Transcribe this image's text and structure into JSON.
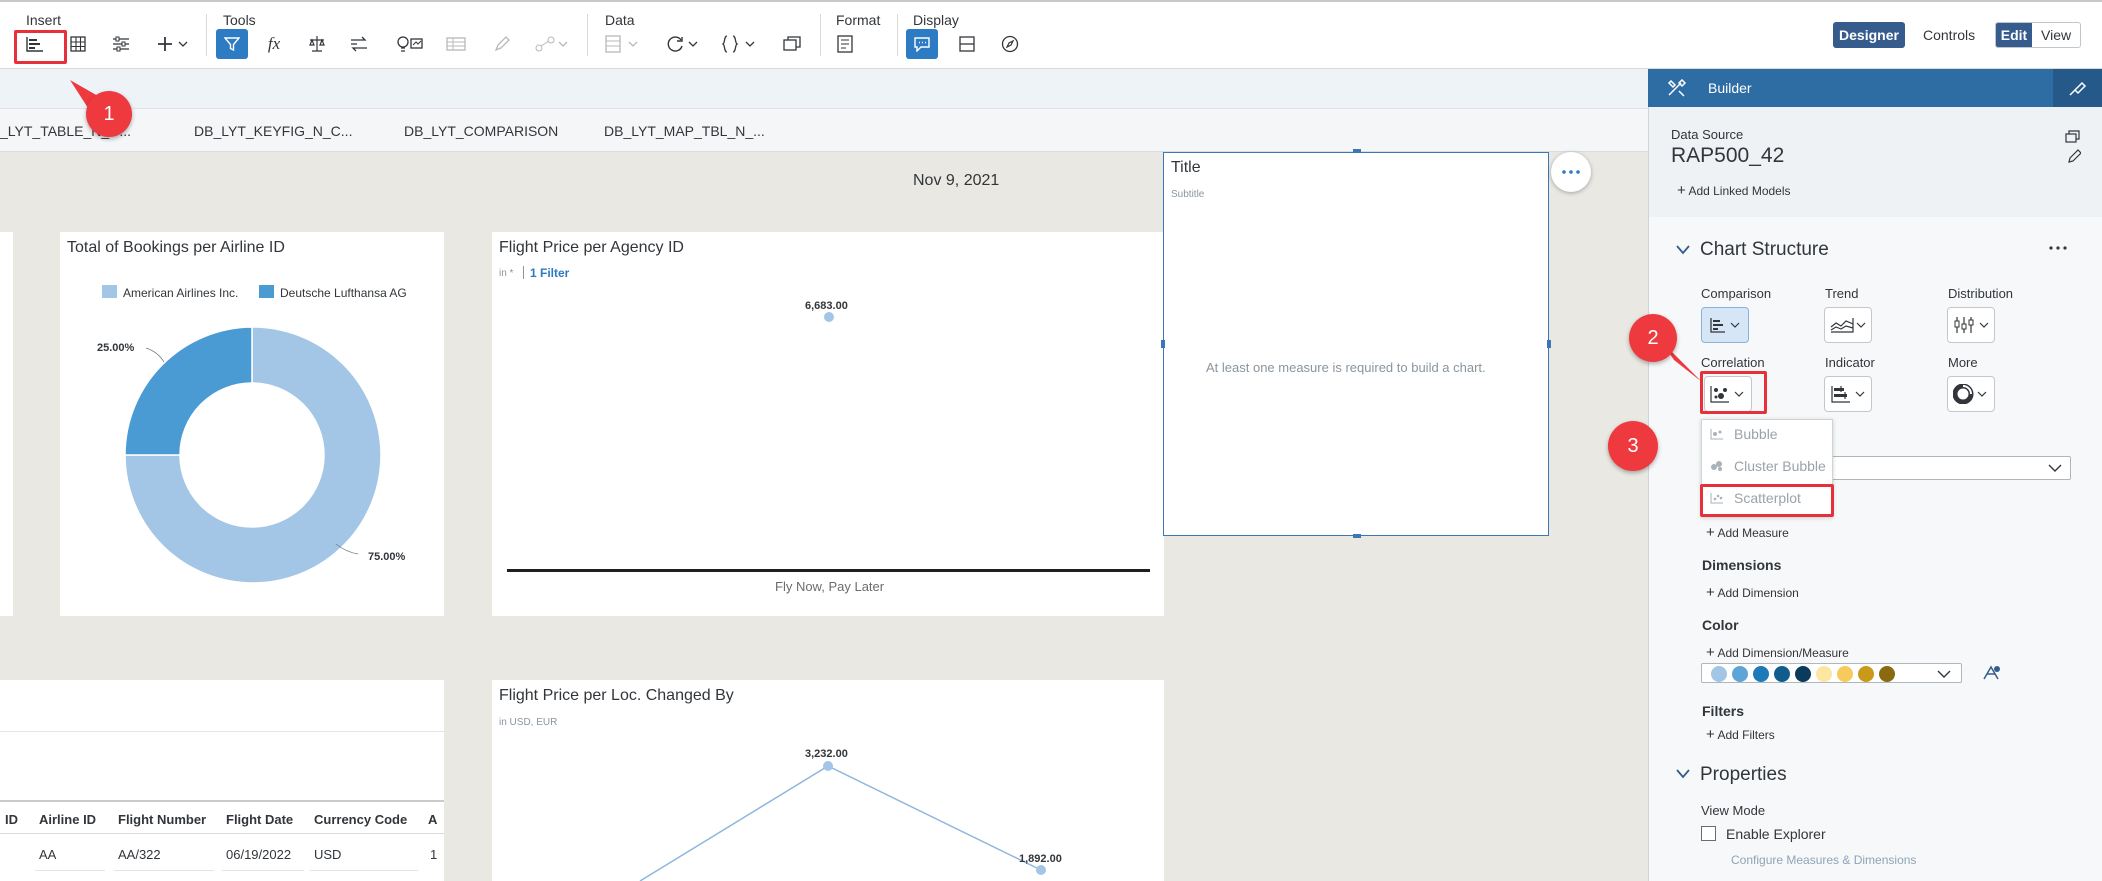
{
  "toolbar": {
    "groups": {
      "insert": "Insert",
      "tools": "Tools",
      "data": "Data",
      "format": "Format",
      "display": "Display"
    },
    "designer": "Designer",
    "controls": "Controls",
    "edit": "Edit",
    "view": "View"
  },
  "tabs": [
    "_LYT_TABLE_N_C...",
    "DB_LYT_KEYFIG_N_C...",
    "DB_LYT_COMPARISON",
    "DB_LYT_MAP_TBL_N_..."
  ],
  "canvas": {
    "date": "Nov 9, 2021"
  },
  "donut_card": {
    "title": "Total of Bookings per Airline ID",
    "legend": [
      "American Airlines Inc.",
      "Deutsche Lufthansa AG"
    ],
    "labels": [
      "25.00%",
      "75.00%"
    ]
  },
  "agency_card": {
    "title": "Flight Price per Agency ID",
    "unit": "in *",
    "filter": "1 Filter",
    "value_label": "6,683.00",
    "axis_label": "Fly Now, Pay Later"
  },
  "empty_card": {
    "title": "Title",
    "subtitle": "Subtitle",
    "message": "At least one measure is required to build a chart."
  },
  "loc_card": {
    "title": "Flight Price per Loc. Changed By",
    "unit": "in USD, EUR",
    "labels": [
      "3,232.00",
      "1,892.00"
    ]
  },
  "table_card": {
    "headers": [
      "ID",
      "Airline ID",
      "Flight Number",
      "Flight Date",
      "Currency Code",
      "A"
    ],
    "row": [
      "",
      "AA",
      "AA/322",
      "06/19/2022",
      "USD",
      "1"
    ]
  },
  "panel": {
    "title": "Builder",
    "data_source_label": "Data Source",
    "data_source": "RAP500_42",
    "add_linked": "Add Linked Models",
    "chart_structure": "Chart Structure",
    "categories": [
      "Comparison",
      "Trend",
      "Distribution",
      "Correlation",
      "Indicator",
      "More"
    ],
    "dropdown": [
      "Bubble",
      "Cluster Bubble",
      "Scatterplot"
    ],
    "add_measure": "Add Measure",
    "dimensions": "Dimensions",
    "add_dimension": "Add Dimension",
    "color": "Color",
    "add_dim_measure": "Add Dimension/Measure",
    "palette": [
      "#a4c6e6",
      "#5fa4d8",
      "#1d7ab7",
      "#0f5d8c",
      "#0b3a5c",
      "#fde5a2",
      "#f6cb5b",
      "#c99a1a",
      "#8a6a0e"
    ],
    "filters": "Filters",
    "add_filters": "Add Filters",
    "properties": "Properties",
    "view_mode": "View Mode",
    "enable_explorer": "Enable Explorer",
    "configure": "Configure Measures & Dimensions"
  },
  "callouts": [
    "1",
    "2",
    "3"
  ]
}
